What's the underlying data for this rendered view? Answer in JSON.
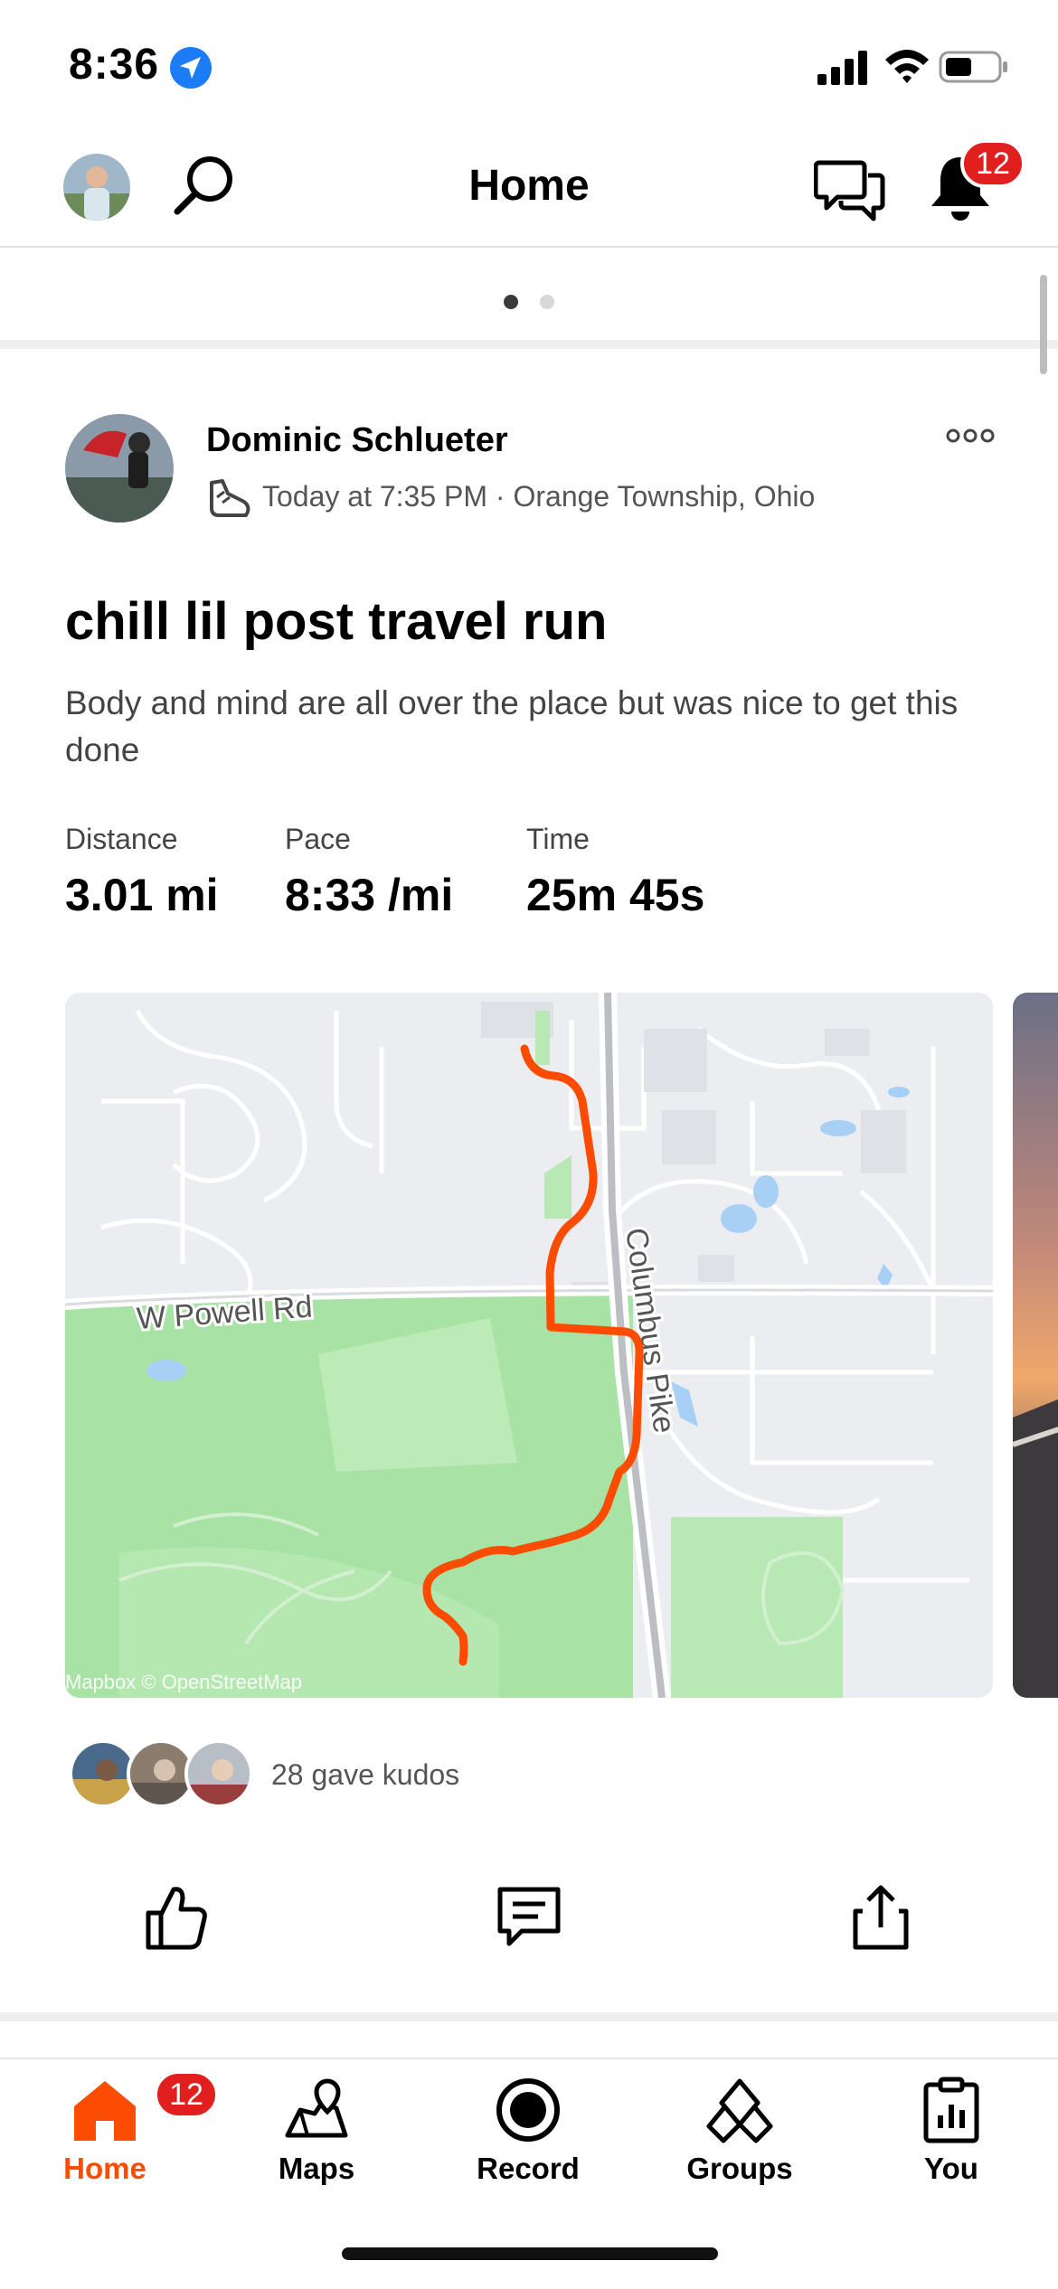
{
  "status_bar": {
    "time": "8:36"
  },
  "header": {
    "title": "Home",
    "notification_count": "12"
  },
  "post": {
    "athlete_name": "Dominic Schlueter",
    "meta": "Today at 7:35 PM · Orange Township, Ohio",
    "title": "chill lil post travel run",
    "description": "Body and mind are all over the place but was nice to get this done",
    "stats": [
      {
        "label": "Distance",
        "value": "3.01 mi"
      },
      {
        "label": "Pace",
        "value": "8:33 /mi"
      },
      {
        "label": "Time",
        "value": "25m 45s"
      }
    ],
    "map": {
      "road_labels": [
        "W Powell Rd",
        "Columbus Pike"
      ],
      "attribution": "Mapbox © OpenStreetMap",
      "route_color": "#fc4c02"
    },
    "kudos_text": "28 gave kudos"
  },
  "tabs": [
    {
      "label": "Home",
      "badge": "12"
    },
    {
      "label": "Maps"
    },
    {
      "label": "Record"
    },
    {
      "label": "Groups"
    },
    {
      "label": "You"
    }
  ],
  "colors": {
    "accent": "#fc4c02",
    "badge": "#e21f1f"
  }
}
